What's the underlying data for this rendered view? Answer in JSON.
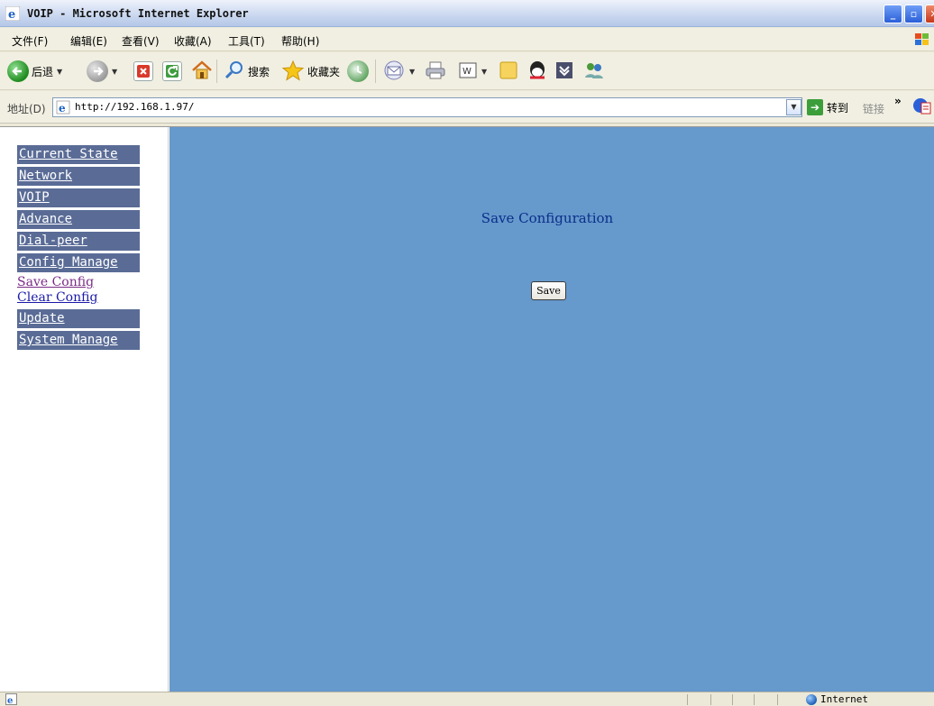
{
  "window": {
    "title": "VOIP - Microsoft Internet Explorer"
  },
  "menu": {
    "items": [
      "文件(F)",
      "编辑(E)",
      "查看(V)",
      "收藏(A)",
      "工具(T)",
      "帮助(H)"
    ]
  },
  "toolbar": {
    "back_label": "后退",
    "search_label": "搜索",
    "favorites_label": "收藏夹"
  },
  "address": {
    "label": "地址(D)",
    "url": "http://192.168.1.97/",
    "go_label": "转到",
    "links_label": "链接",
    "more": "»"
  },
  "sidebar": {
    "current_state": "Current State",
    "network": "Network",
    "voip": "VOIP",
    "advance": "Advance",
    "dial_peer": "Dial-peer",
    "config_manage": "Config Manage",
    "save_config": "Save Config",
    "clear_config": "Clear Config",
    "update": "Update",
    "system_manage": "System Manage"
  },
  "main": {
    "heading": "Save Configuration",
    "save_button": "Save"
  },
  "status": {
    "zone": "Internet"
  },
  "colors": {
    "main_background": "#6699cc",
    "nav_button": "#5a6c96",
    "heading_text": "#0a2f8a"
  }
}
